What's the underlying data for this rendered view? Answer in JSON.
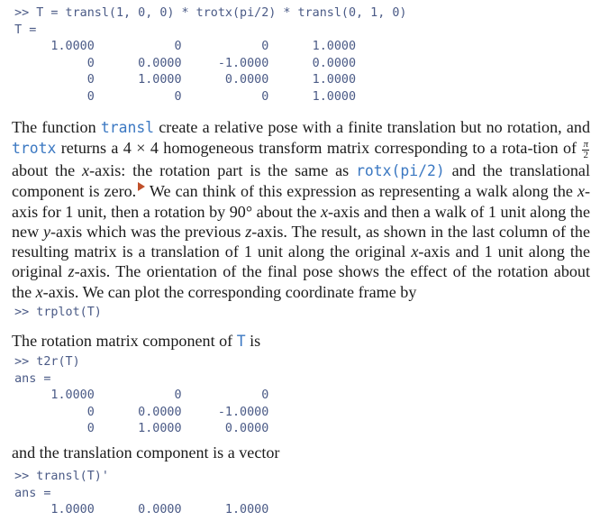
{
  "code1": {
    "lines": [
      "  >> T = transl(1, 0, 0) * trotx(pi/2) * transl(0, 1, 0)",
      "  T =",
      "       1.0000           0           0      1.0000",
      "            0      0.0000     -1.0000      0.0000",
      "            0      1.0000      0.0000      1.0000",
      "            0           0           0      1.0000"
    ]
  },
  "para1": {
    "p1": "The function ",
    "c1": "transl",
    "p2": " create a relative pose with a finite translation but no rotation, and ",
    "c2": "trotx",
    "p3": " returns a 4 × 4 homogeneous transform matrix corresponding to a rota-tion of ",
    "frac_num": "π",
    "frac_den": "2",
    "p4": " about the ",
    "v1": "x",
    "p5": "-axis: the rotation part is the same as ",
    "c3": "rotx(pi/2)",
    "p6": " and the translational component is zero.",
    "p7": " We can think of this expression as representing a walk along the ",
    "v2": "x",
    "p8": "-axis for 1 unit, then a rotation by 90° about the ",
    "v3": "x",
    "p9": "-axis and then a walk of 1 unit along the new ",
    "v4": "y",
    "p10": "-axis which was the previous ",
    "v5": "z",
    "p11": "-axis. The result, as shown in the last column of the resulting matrix is a translation of 1 unit along the original ",
    "v6": "x",
    "p12": "-axis and 1 unit along the original ",
    "v7": "z",
    "p13": "-axis. The orientation of the final pose shows the effect of the rotation about the ",
    "v8": "x",
    "p14": "-axis. We can plot the corresponding coordinate frame by"
  },
  "code2": {
    "lines": [
      "  >> trplot(T)"
    ]
  },
  "para2": {
    "p1": "The rotation matrix component of ",
    "c1": "T",
    "p2": " is"
  },
  "code3": {
    "lines": [
      "  >> t2r(T)",
      "  ans =",
      "       1.0000           0           0",
      "            0      0.0000     -1.0000",
      "            0      1.0000      0.0000"
    ]
  },
  "para3": {
    "p1": "and the translation component is a vector"
  },
  "code4": {
    "lines": [
      "  >> transl(T)'",
      "  ans =",
      "       1.0000      0.0000      1.0000"
    ]
  }
}
